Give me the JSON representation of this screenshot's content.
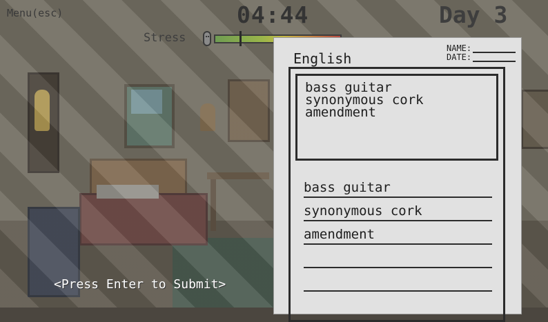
{
  "hud": {
    "menu_label": "Menu(esc)",
    "timer": "04:44",
    "day": "Day 3",
    "stress_label": "Stress",
    "stress_level": 0.2
  },
  "paper": {
    "subject": "English",
    "name_label": "NAME:",
    "date_label": "DATE:",
    "question_lines": [
      "bass guitar",
      "synonymous cork",
      "amendment"
    ],
    "answers": [
      "bass guitar",
      "synonymous cork",
      "amendment",
      "",
      ""
    ]
  },
  "prompt": {
    "submit_label": "<Press Enter to Submit>"
  },
  "colors": {
    "paper": "#e1e1e1",
    "ink": "#1d1d1d",
    "stress_low": "#6f9c52",
    "stress_high": "#b94b43"
  }
}
